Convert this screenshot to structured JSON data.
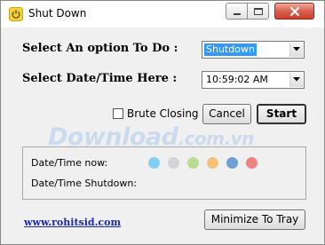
{
  "window": {
    "title": "Shut Down"
  },
  "form": {
    "option_label": "Select An option To Do :",
    "option_value": "Shutdown",
    "datetime_label": "Select Date/Time Here :",
    "datetime_value": "10:59:02 AM"
  },
  "controls": {
    "brute_label": "Brute Closing",
    "brute_checked": false,
    "cancel_label": "Cancel",
    "start_label": "Start"
  },
  "watermark": {
    "main": "Download",
    "suffix": ".com.vn"
  },
  "status": {
    "now_label": "Date/Time now:",
    "shutdown_label": "Date/Time Shutdown:",
    "dots": [
      "#7fd0f2",
      "#d3d3da",
      "#b7dd93",
      "#f5c27a",
      "#6f9fd3",
      "#ee8282"
    ]
  },
  "footer": {
    "link": "www.rohitsid.com",
    "minimize_label": "Minimize To Tray"
  }
}
